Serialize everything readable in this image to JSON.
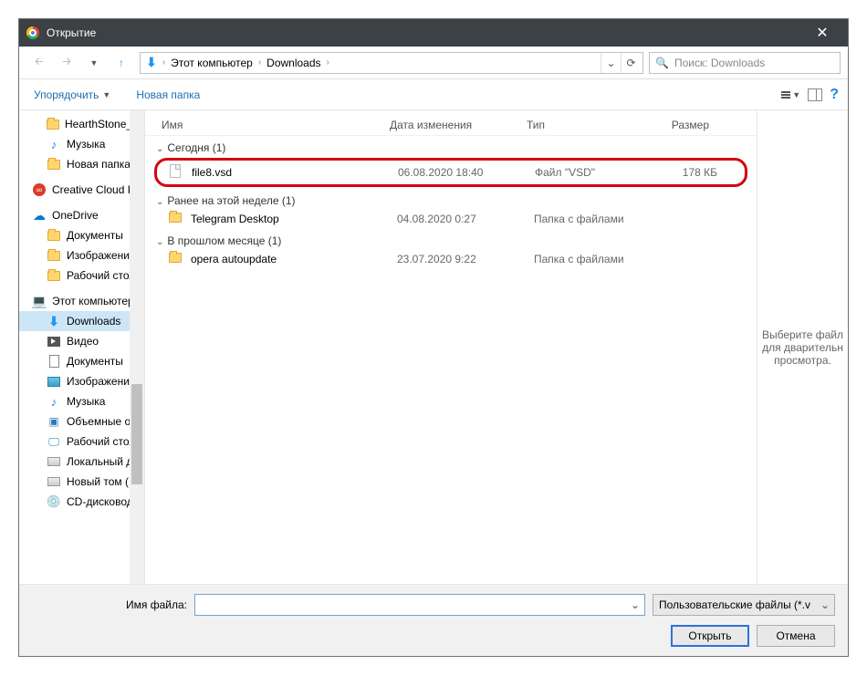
{
  "titlebar": {
    "title": "Открытие"
  },
  "nav": {
    "breadcrumb": {
      "root": "Этот компьютер",
      "folder": "Downloads"
    },
    "search_placeholder": "Поиск: Downloads"
  },
  "toolbar": {
    "organize": "Упорядочить",
    "newfolder": "Новая папка"
  },
  "sidebar": {
    "hearthstone": "HearthStone_He",
    "music": "Музыка",
    "newfolder": "Новая папка",
    "cc": "Creative Cloud Fil",
    "onedrive": "OneDrive",
    "documents": "Документы",
    "pictures": "Изображения",
    "desktop": "Рабочий стол",
    "thispc": "Этот компьютер",
    "downloads": "Downloads",
    "video": "Видео",
    "documents2": "Документы",
    "pictures2": "Изображения",
    "music2": "Музыка",
    "objects3d": "Объемные объ",
    "desktop2": "Рабочий стол",
    "localdisk": "Локальный дис",
    "newvol": "Новый том (D:)",
    "cddrive": "CD-дисковод (F"
  },
  "columns": {
    "name": "Имя",
    "date": "Дата изменения",
    "type": "Тип",
    "size": "Размер"
  },
  "groups": {
    "today": "Сегодня (1)",
    "earlier_week": "Ранее на этой неделе (1)",
    "last_month": "В прошлом месяце (1)"
  },
  "files": {
    "file8": {
      "name": "file8.vsd",
      "date": "06.08.2020 18:40",
      "type": "Файл \"VSD\"",
      "size": "178 КБ"
    },
    "telegram": {
      "name": "Telegram Desktop",
      "date": "04.08.2020 0:27",
      "type": "Папка с файлами",
      "size": ""
    },
    "opera": {
      "name": "opera autoupdate",
      "date": "23.07.2020 9:22",
      "type": "Папка с файлами",
      "size": ""
    }
  },
  "preview": {
    "text": "Выберите файл для дварительн просмотра."
  },
  "footer": {
    "filename_label": "Имя файла:",
    "filetype": "Пользовательские файлы (*.v",
    "open": "Открыть",
    "cancel": "Отмена"
  }
}
